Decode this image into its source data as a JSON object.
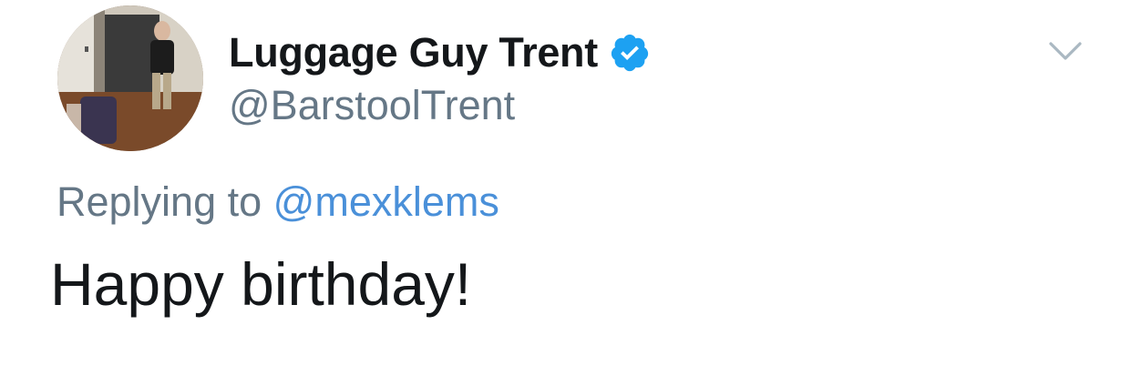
{
  "author": {
    "display_name": "Luggage Guy Trent",
    "handle": "@BarstoolTrent",
    "verified": true
  },
  "reply": {
    "prefix": "Replying to",
    "to_handle": "@mexklems"
  },
  "tweet": {
    "text": "Happy birthday!"
  },
  "icons": {
    "verified": "verified-badge-icon",
    "menu": "chevron-down-icon"
  },
  "colors": {
    "name": "#14171a",
    "secondary": "#657786",
    "link": "#4a90d9",
    "verified": "#1da1f2",
    "caret": "#aab8c2"
  }
}
